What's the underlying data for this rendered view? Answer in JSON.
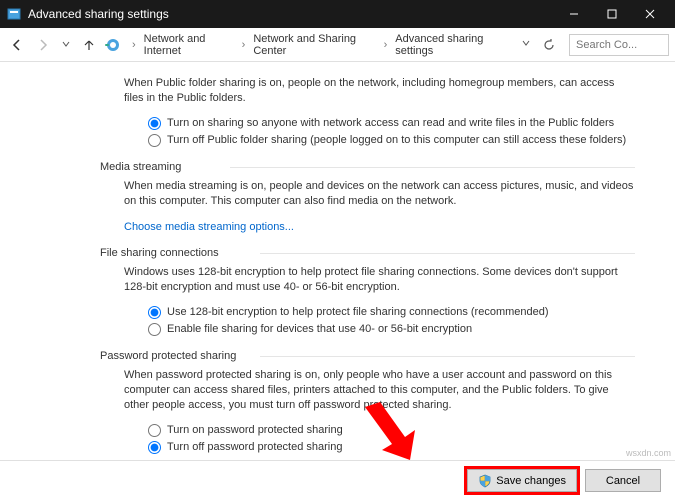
{
  "window": {
    "title": "Advanced sharing settings"
  },
  "breadcrumbs": {
    "b1": "Network and Internet",
    "b2": "Network and Sharing Center",
    "b3": "Advanced sharing settings"
  },
  "search": {
    "placeholder": "Search Co..."
  },
  "public_folder": {
    "desc": "When Public folder sharing is on, people on the network, including homegroup members, can access files in the Public folders.",
    "opt_on": "Turn on sharing so anyone with network access can read and write files in the Public folders",
    "opt_off": "Turn off Public folder sharing (people logged on to this computer can still access these folders)"
  },
  "media": {
    "heading": "Media streaming",
    "desc": "When media streaming is on, people and devices on the network can access pictures, music, and videos on this computer. This computer can also find media on the network.",
    "link": "Choose media streaming options..."
  },
  "filesharing": {
    "heading": "File sharing connections",
    "desc": "Windows uses 128-bit encryption to help protect file sharing connections. Some devices don't support 128-bit encryption and must use 40- or 56-bit encryption.",
    "opt_128": "Use 128-bit encryption to help protect file sharing connections (recommended)",
    "opt_4056": "Enable file sharing for devices that use 40- or 56-bit encryption"
  },
  "password": {
    "heading": "Password protected sharing",
    "desc": "When password protected sharing is on, only people who have a user account and password on this computer can access shared files, printers attached to this computer, and the Public folders. To give other people access, you must turn off password protected sharing.",
    "opt_on": "Turn on password protected sharing",
    "opt_off": "Turn off password protected sharing"
  },
  "footer": {
    "save": "Save changes",
    "cancel": "Cancel"
  },
  "watermark": "wsxdn.com"
}
